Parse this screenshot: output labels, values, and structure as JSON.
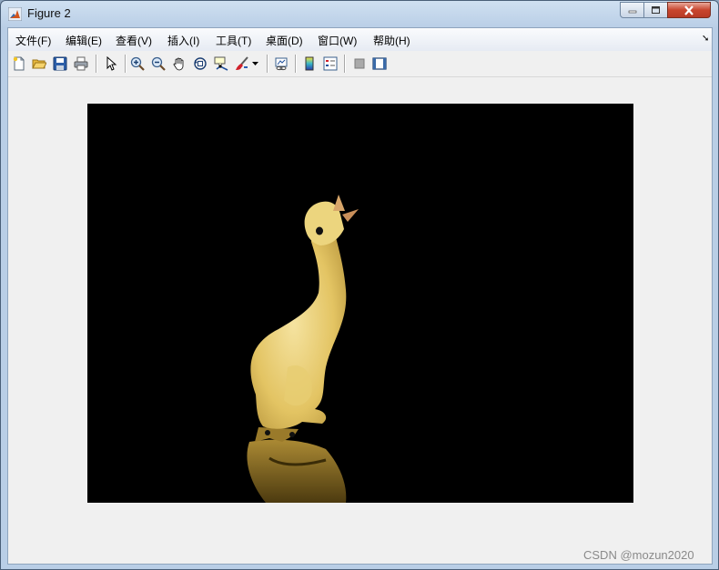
{
  "window": {
    "title": "Figure 2"
  },
  "menu": {
    "items": [
      {
        "label": "文件(F)"
      },
      {
        "label": "编辑(E)"
      },
      {
        "label": "查看(V)"
      },
      {
        "label": "插入(I)"
      },
      {
        "label": "工具(T)"
      },
      {
        "label": "桌面(D)"
      },
      {
        "label": "窗口(W)"
      },
      {
        "label": "帮助(H)"
      }
    ]
  },
  "toolbar": {
    "buttons": [
      "new-figure",
      "open-file",
      "save-figure",
      "print-figure",
      "edit-plot",
      "zoom-in",
      "zoom-out",
      "pan",
      "rotate-3d",
      "data-cursor",
      "brush",
      "link-plot",
      "insert-colorbar",
      "insert-legend",
      "hide-plot-tools",
      "show-plot-tools"
    ]
  },
  "figure": {
    "image": "yellow duckling standing upright with beak raised, on a black background, with its reflection below"
  },
  "watermark": "CSDN @mozun2020"
}
